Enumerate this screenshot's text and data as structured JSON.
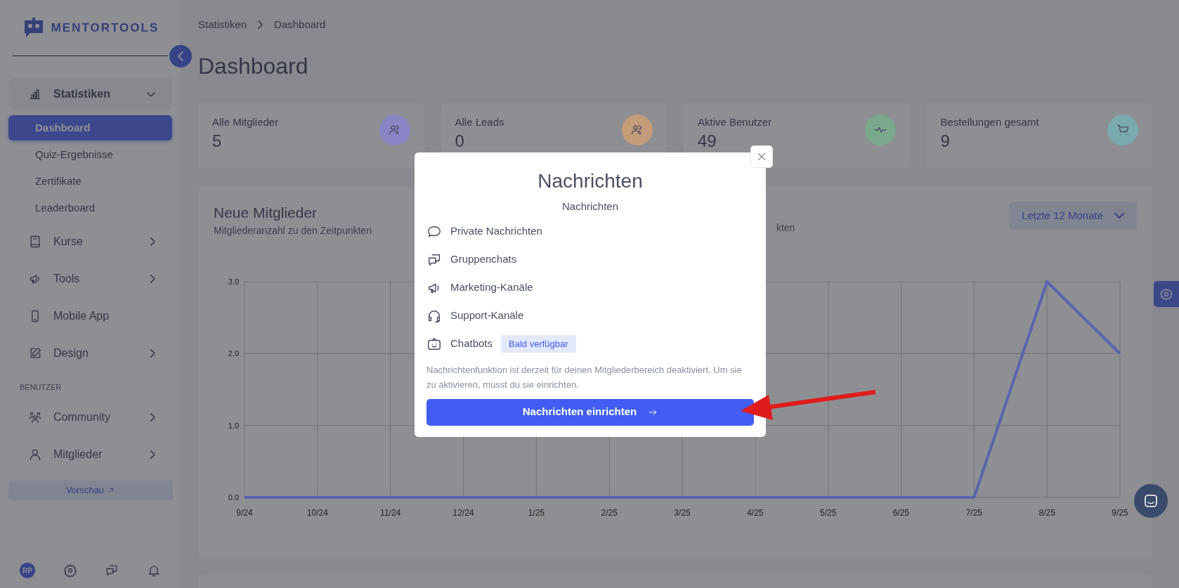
{
  "logo": {
    "text": "MENTORTOOLS"
  },
  "sidebar": {
    "sections": [
      {
        "items": [
          {
            "label": "Statistiken",
            "kind": "group",
            "expanded": true,
            "children": [
              {
                "label": "Dashboard",
                "selected": true
              },
              {
                "label": "Quiz-Ergebnisse",
                "selected": false
              },
              {
                "label": "Zertifikate",
                "selected": false
              },
              {
                "label": "Leaderboard",
                "selected": false
              }
            ]
          },
          {
            "label": "Kurse",
            "kind": "group",
            "expanded": false
          },
          {
            "label": "Tools",
            "kind": "group",
            "expanded": false
          },
          {
            "label": "Mobile App",
            "kind": "link"
          },
          {
            "label": "Design",
            "kind": "group",
            "expanded": false
          }
        ]
      },
      {
        "title": "BENUTZER",
        "items": [
          {
            "label": "Community",
            "kind": "group",
            "expanded": false
          },
          {
            "label": "Mitglieder",
            "kind": "group",
            "expanded": false
          }
        ]
      }
    ],
    "preview_button": "Vorschau",
    "avatar": "RP"
  },
  "breadcrumb": [
    "Statistiken",
    "Dashboard"
  ],
  "page_title": "Dashboard",
  "stats": [
    {
      "label": "Alle Mitglieder",
      "value": "5",
      "color": "#8a85c4"
    },
    {
      "label": "Alle Leads",
      "value": "0",
      "color": "#c49c7a"
    },
    {
      "label": "Aktive Benutzer",
      "value": "49",
      "color": "#7aa88c"
    },
    {
      "label": "Bestellungen gesamt",
      "value": "9",
      "color": "#7aa9b0"
    }
  ],
  "chart_card": {
    "title": "Neue Mitglieder",
    "subtitle": "Mitgliederanzahl zu den Zeitpunkten",
    "hidden_text": "kten",
    "range": "Letzte 12 Monate",
    "chart_data": {
      "type": "line",
      "categories": [
        "9/24",
        "10/24",
        "11/24",
        "12/24",
        "1/25",
        "2/25",
        "3/25",
        "4/25",
        "5/25",
        "6/25",
        "7/25",
        "8/25",
        "9/25"
      ],
      "series": [
        {
          "color": "#5a63ad",
          "values": [
            0,
            0,
            0,
            0,
            0,
            0,
            0,
            0,
            0,
            0,
            0,
            3,
            2
          ]
        }
      ],
      "grid": true,
      "ylim": [
        0,
        3
      ],
      "yticks": [
        {
          "value": 0,
          "label": "0.0"
        },
        {
          "value": 1,
          "label": "1.0"
        },
        {
          "value": 2,
          "label": "2.0"
        },
        {
          "value": 3,
          "label": "3.0"
        }
      ]
    }
  },
  "modal": {
    "title": "Nachrichten",
    "subtitle": "Nachrichten",
    "features": [
      {
        "label": "Private Nachrichten"
      },
      {
        "label": "Gruppenchats"
      },
      {
        "label": "Marketing-Kanäle"
      },
      {
        "label": "Support-Kanäle"
      },
      {
        "label": "Chatbots",
        "badge": "Bald verfügbar"
      }
    ],
    "note": "Nachrichtenfunktion ist derzeit für deinen Mitgliederbereich deaktiviert. Um sie zu aktivieren, musst du sie einrichten.",
    "button": "Nachrichten einrichten"
  }
}
